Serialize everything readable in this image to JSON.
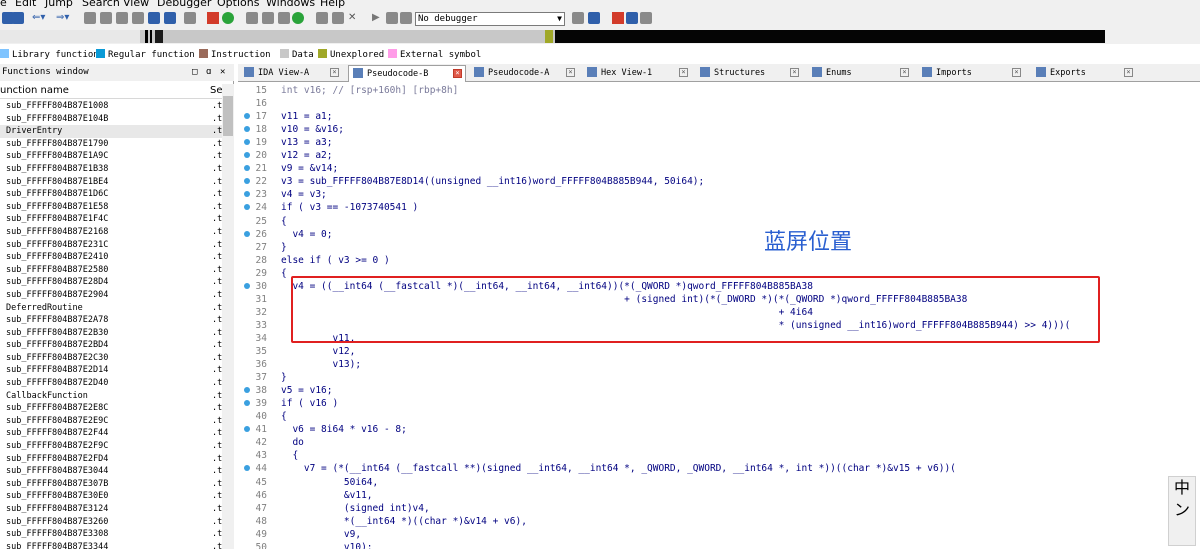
{
  "menu": [
    "e",
    "Edit",
    "Jump",
    "Search",
    "View",
    "Debugger",
    "Options",
    "Windows",
    "Help"
  ],
  "toolbar": {
    "debugger_select": "No debugger"
  },
  "legend": [
    {
      "label": "Library function",
      "color": "#7fc4ff"
    },
    {
      "label": "Regular function",
      "color": "#0a9ad6"
    },
    {
      "label": "Instruction",
      "color": "#9a6a5a"
    },
    {
      "label": "Data",
      "color": "#c8c8c8"
    },
    {
      "label": "Unexplored",
      "color": "#a0a828"
    },
    {
      "label": "External symbol",
      "color": "#ff9ce8"
    }
  ],
  "functions_window": {
    "title": "Functions window",
    "col_name": "unction name",
    "col_segment": "Se",
    "items": [
      {
        "name": "sub_FFFFF804B87E1008",
        "seg": ".t"
      },
      {
        "name": "sub_FFFFF804B87E104B",
        "seg": ".t"
      },
      {
        "name": "DriverEntry",
        "seg": ".t"
      },
      {
        "name": "sub_FFFFF804B87E1790",
        "seg": ".t"
      },
      {
        "name": "sub_FFFFF804B87E1A9C",
        "seg": ".t"
      },
      {
        "name": "sub_FFFFF804B87E1B38",
        "seg": ".t"
      },
      {
        "name": "sub_FFFFF804B87E1BE4",
        "seg": ".t"
      },
      {
        "name": "sub_FFFFF804B87E1D6C",
        "seg": ".t"
      },
      {
        "name": "sub_FFFFF804B87E1E58",
        "seg": ".t"
      },
      {
        "name": "sub_FFFFF804B87E1F4C",
        "seg": ".t"
      },
      {
        "name": "sub_FFFFF804B87E2168",
        "seg": ".t"
      },
      {
        "name": "sub_FFFFF804B87E231C",
        "seg": ".t"
      },
      {
        "name": "sub_FFFFF804B87E2410",
        "seg": ".t"
      },
      {
        "name": "sub_FFFFF804B87E2580",
        "seg": ".t"
      },
      {
        "name": "sub_FFFFF804B87E28D4",
        "seg": ".t"
      },
      {
        "name": "sub_FFFFF804B87E2904",
        "seg": ".t"
      },
      {
        "name": "DeferredRoutine",
        "seg": ".t"
      },
      {
        "name": "sub_FFFFF804B87E2A78",
        "seg": ".t"
      },
      {
        "name": "sub_FFFFF804B87E2B30",
        "seg": ".t"
      },
      {
        "name": "sub_FFFFF804B87E2BD4",
        "seg": ".t"
      },
      {
        "name": "sub_FFFFF804B87E2C30",
        "seg": ".t"
      },
      {
        "name": "sub_FFFFF804B87E2D14",
        "seg": ".t"
      },
      {
        "name": "sub_FFFFF804B87E2D40",
        "seg": ".t"
      },
      {
        "name": "CallbackFunction",
        "seg": ".t"
      },
      {
        "name": "sub_FFFFF804B87E2E8C",
        "seg": ".t"
      },
      {
        "name": "sub_FFFFF804B87E2E9C",
        "seg": ".t"
      },
      {
        "name": "sub_FFFFF804B87E2F44",
        "seg": ".t"
      },
      {
        "name": "sub_FFFFF804B87E2F9C",
        "seg": ".t"
      },
      {
        "name": "sub_FFFFF804B87E2FD4",
        "seg": ".t"
      },
      {
        "name": "sub_FFFFF804B87E3044",
        "seg": ".t"
      },
      {
        "name": "sub_FFFFF804B87E307B",
        "seg": ".t"
      },
      {
        "name": "sub_FFFFF804B87E30E0",
        "seg": ".t"
      },
      {
        "name": "sub_FFFFF804B87E3124",
        "seg": ".t"
      },
      {
        "name": "sub_FFFFF804B87E3260",
        "seg": ".t"
      },
      {
        "name": "sub_FFFFF804B87E3308",
        "seg": ".t"
      },
      {
        "name": "sub_FFFFF804B87E3344",
        "seg": ".t"
      }
    ]
  },
  "tabs": [
    {
      "label": "IDA View-A",
      "active": false
    },
    {
      "label": "Pseudocode-B",
      "active": true
    },
    {
      "label": "Pseudocode-A",
      "active": false
    },
    {
      "label": "Hex View-1",
      "active": false
    },
    {
      "label": "Structures",
      "active": false
    },
    {
      "label": "Enums",
      "active": false
    },
    {
      "label": "Imports",
      "active": false
    },
    {
      "label": "Exports",
      "active": false
    }
  ],
  "code_lines": [
    {
      "ln": "15",
      "dot": false,
      "text": "int v16; // [rsp+160h] [rbp+8h]",
      "muted": true
    },
    {
      "ln": "16",
      "dot": false,
      "text": ""
    },
    {
      "ln": "17",
      "dot": true,
      "text": "v11 = a1;"
    },
    {
      "ln": "18",
      "dot": true,
      "text": "v10 = &v16;"
    },
    {
      "ln": "19",
      "dot": true,
      "text": "v13 = a3;"
    },
    {
      "ln": "20",
      "dot": true,
      "text": "v12 = a2;"
    },
    {
      "ln": "21",
      "dot": true,
      "text": "v9 = &v14;"
    },
    {
      "ln": "22",
      "dot": true,
      "text": "v3 = sub_FFFFF804B87E8D14((unsigned __int16)word_FFFFF804B885B944, 50i64);"
    },
    {
      "ln": "23",
      "dot": true,
      "text": "v4 = v3;"
    },
    {
      "ln": "24",
      "dot": true,
      "text": "if ( v3 == -1073740541 )"
    },
    {
      "ln": "25",
      "dot": false,
      "text": "{"
    },
    {
      "ln": "26",
      "dot": true,
      "text": "  v4 = 0;"
    },
    {
      "ln": "27",
      "dot": false,
      "text": "}"
    },
    {
      "ln": "28",
      "dot": false,
      "text": "else if ( v3 >= 0 )"
    },
    {
      "ln": "29",
      "dot": false,
      "text": "{"
    },
    {
      "ln": "30",
      "dot": true,
      "text": "  v4 = ((__int64 (__fastcall *)(__int64, __int64, __int64))(*(_QWORD *)qword_FFFFF804B885BA38"
    },
    {
      "ln": "31",
      "dot": false,
      "text": "                                                            + (signed int)(*(_DWORD *)(*(_QWORD *)qword_FFFFF804B885BA38"
    },
    {
      "ln": "32",
      "dot": false,
      "text": "                                                                                       + 4i64"
    },
    {
      "ln": "33",
      "dot": false,
      "text": "                                                                                       * (unsigned __int16)word_FFFFF804B885B944) >> 4)))("
    },
    {
      "ln": "34",
      "dot": false,
      "text": "         v11,"
    },
    {
      "ln": "35",
      "dot": false,
      "text": "         v12,"
    },
    {
      "ln": "36",
      "dot": false,
      "text": "         v13);"
    },
    {
      "ln": "37",
      "dot": false,
      "text": "}"
    },
    {
      "ln": "38",
      "dot": true,
      "text": "v5 = v16;"
    },
    {
      "ln": "39",
      "dot": true,
      "text": "if ( v16 )"
    },
    {
      "ln": "40",
      "dot": false,
      "text": "{"
    },
    {
      "ln": "41",
      "dot": true,
      "text": "  v6 = 8i64 * v16 - 8;"
    },
    {
      "ln": "42",
      "dot": false,
      "text": "  do"
    },
    {
      "ln": "43",
      "dot": false,
      "text": "  {"
    },
    {
      "ln": "44",
      "dot": true,
      "text": "    v7 = (*(__int64 (__fastcall **)(signed __int64, __int64 *, _QWORD, _QWORD, __int64 *, int *))((char *)&v15 + v6))("
    },
    {
      "ln": "45",
      "dot": false,
      "text": "           50i64,"
    },
    {
      "ln": "46",
      "dot": false,
      "text": "           &v11,"
    },
    {
      "ln": "47",
      "dot": false,
      "text": "           (signed int)v4,"
    },
    {
      "ln": "48",
      "dot": false,
      "text": "           *(__int64 *)((char *)&v14 + v6),"
    },
    {
      "ln": "49",
      "dot": false,
      "text": "           v9,"
    },
    {
      "ln": "50",
      "dot": false,
      "text": "           v10);"
    }
  ],
  "annotation": "蓝屏位置",
  "ime": {
    "line1": "中",
    "line2": "ン"
  }
}
